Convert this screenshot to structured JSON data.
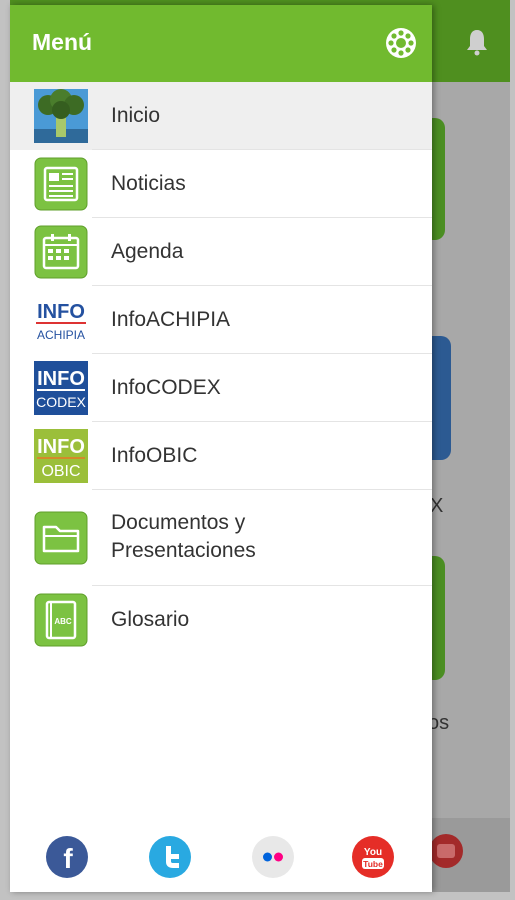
{
  "drawer": {
    "title": "Menú",
    "items": [
      {
        "label": "Inicio",
        "icon": "broccoli-icon"
      },
      {
        "label": "Noticias",
        "icon": "newspaper-icon"
      },
      {
        "label": "Agenda",
        "icon": "calendar-icon"
      },
      {
        "label": "InfoACHIPIA",
        "icon": "info-achipia-logo",
        "logo_top": "INFO",
        "logo_bottom": "ACHIPIA"
      },
      {
        "label": "InfoCODEX",
        "icon": "info-codex-logo",
        "logo_top": "INFO",
        "logo_bottom": "CODEX"
      },
      {
        "label": "InfoOBIC",
        "icon": "info-obic-logo",
        "logo_top": "INFO",
        "logo_bottom": "OBIC"
      },
      {
        "label_line1": "Documentos y",
        "label_line2": "Presentaciones",
        "icon": "folder-icon"
      },
      {
        "label": "Glosario",
        "icon": "glossary-book-icon",
        "icon_text": "ABC"
      }
    ],
    "social": [
      {
        "name": "facebook-icon",
        "glyph": "f",
        "color": "#3b5998"
      },
      {
        "name": "twitter-icon",
        "color": "#29a9e1"
      },
      {
        "name": "flickr-icon",
        "color": "#e8e8e8"
      },
      {
        "name": "youtube-icon",
        "glyph_top": "You",
        "glyph_bottom": "Tube",
        "color": "#e52d27"
      }
    ]
  },
  "background": {
    "partial_text_1": "X",
    "partial_text_2": "os"
  },
  "colors": {
    "header_green": "#71ba2f",
    "icon_green": "#7cc242",
    "active_row": "#efefef"
  }
}
